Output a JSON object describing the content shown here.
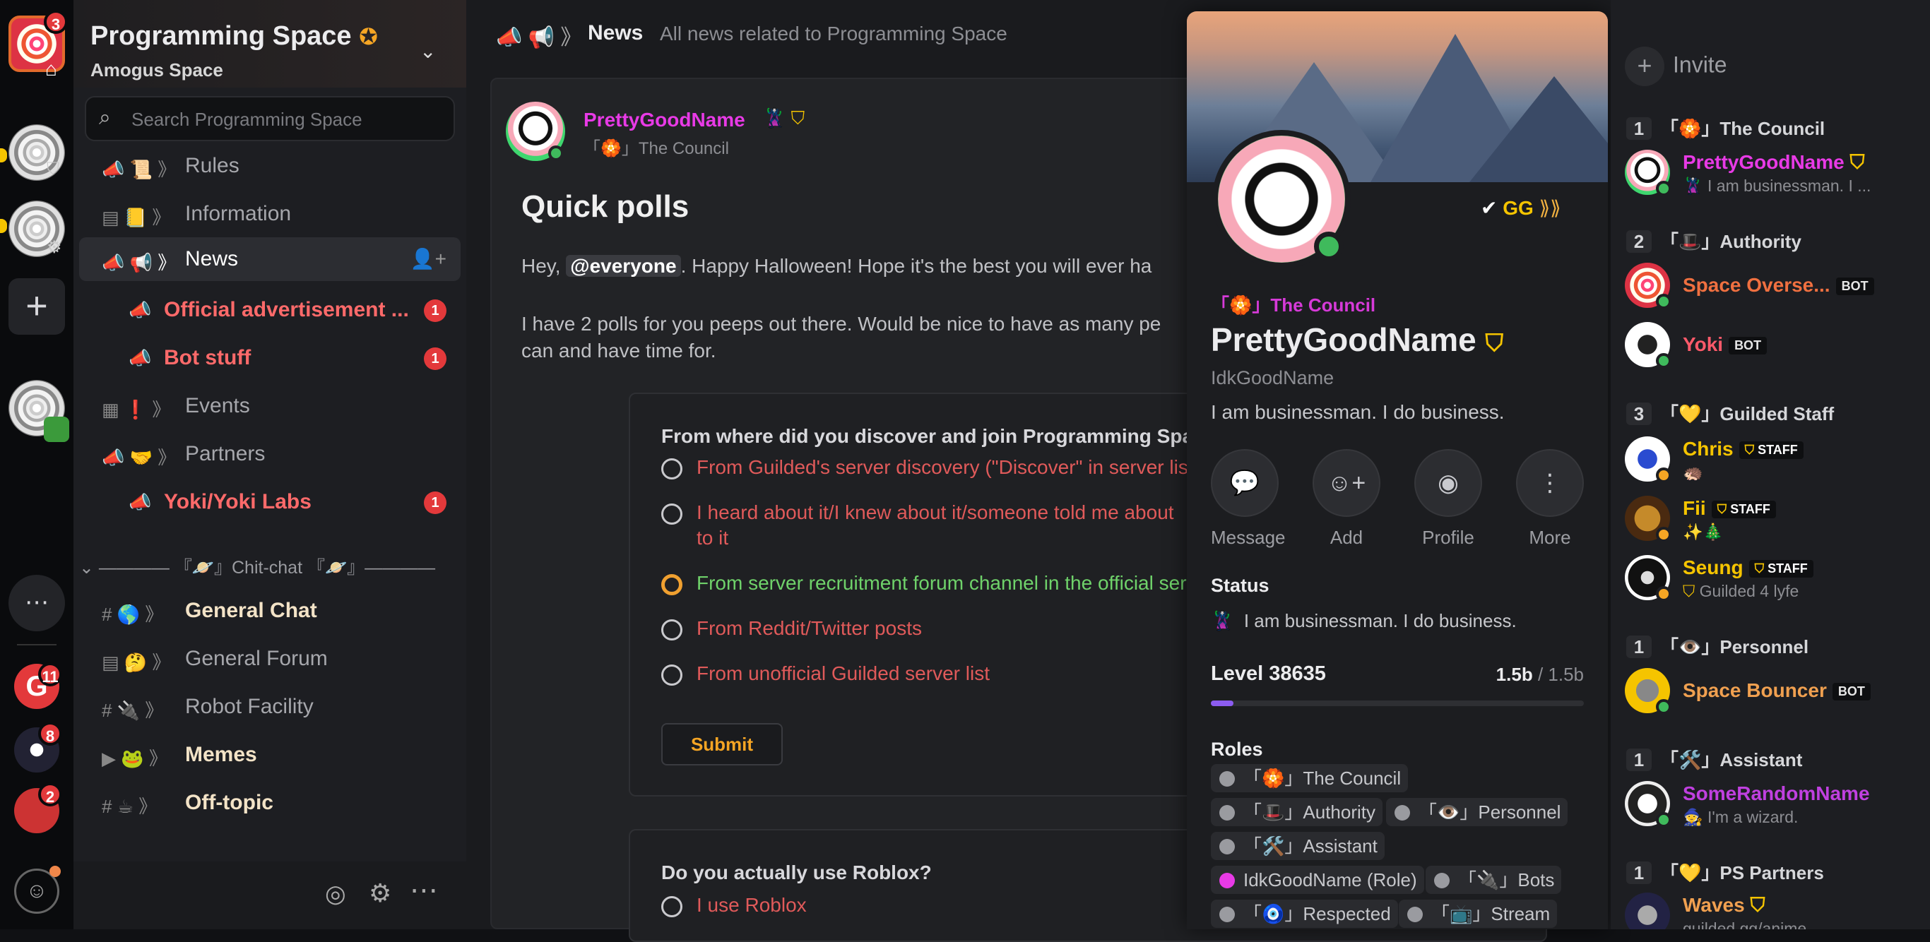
{
  "server": {
    "name": "Programming Space",
    "subtitle": "Amogus Space",
    "search_placeholder": "Search Programming Space",
    "rail_badges": [
      "3",
      "11",
      "8",
      "2"
    ]
  },
  "channels": [
    {
      "icon": "📜",
      "label": "Rules"
    },
    {
      "icon": "📒",
      "label": "Information"
    },
    {
      "icon": "📢",
      "label": "News"
    },
    {
      "icon": "",
      "label": "Official advertisement ...",
      "unread": "1"
    },
    {
      "icon": "",
      "label": "Bot stuff",
      "unread": "1"
    },
    {
      "icon": "❗",
      "label": "Events"
    },
    {
      "icon": "🤝",
      "label": "Partners"
    },
    {
      "icon": "",
      "label": "Yoki/Yoki Labs",
      "unread": "1"
    },
    {
      "icon": "🌎",
      "label": "General Chat"
    },
    {
      "icon": "🤔",
      "label": "General Forum"
    },
    {
      "icon": "🔌",
      "label": "Robot Facility"
    },
    {
      "icon": "🐸",
      "label": "Memes"
    },
    {
      "icon": "☕",
      "label": "Off-topic"
    }
  ],
  "category": "———— 『🪐』Chit-chat 『🪐』————",
  "topbar": {
    "title": "News",
    "description": "All news related to Programming Space"
  },
  "post": {
    "author": "PrettyGoodName",
    "author_role": "「🏵️」The Council",
    "title": "Quick polls",
    "line1_pre": "Hey, ",
    "mention": "@everyone",
    "line1_post": ". Happy Halloween! Hope it's the best you will ever ha",
    "line2": "I have 2 polls for you peeps out there. Would be nice to have as many pe",
    "line3": "can and have time for.",
    "poll1": {
      "question": "From where did you discover and join Programming Spac",
      "options": [
        "From Guilded's server discovery (\"Discover\" in server lis",
        "I heard about it/I knew about it/someone told me about",
        "to it",
        "From server recruitment forum channel in the official ser",
        "From Reddit/Twitter posts",
        "From unofficial Guilded server list"
      ],
      "submit": "Submit"
    },
    "poll2": {
      "question": "Do you actually use Roblox?",
      "option1": "I use Roblox"
    }
  },
  "card": {
    "role": "「🏵️」The Council",
    "name": "PrettyGoodName",
    "username": "IdkGoodName",
    "bio": "I am businessman. I do business.",
    "actions": [
      {
        "label": "Message"
      },
      {
        "label": "Add"
      },
      {
        "label": "Profile"
      },
      {
        "label": "More"
      }
    ],
    "status_title": "Status",
    "status_text": "I am businessman. I do business.",
    "level_label": "Level 38635",
    "xp": "1.5b",
    "xp_max": "/ 1.5b",
    "level_progress": 0.06,
    "roles_title": "Roles",
    "roles": [
      "「🏵️」The Council",
      "「🎩」Authority",
      "「👁️」Personnel",
      "「🛠️」Assistant",
      "IdkGoodName (Role)",
      "「🔌」Bots",
      "「🧿」Respected",
      "「📺」Stream"
    ],
    "badge_text": "GG"
  },
  "members": {
    "invite": "Invite",
    "groups": [
      {
        "count": "1",
        "name": "「🏵️」The Council"
      },
      {
        "count": "2",
        "name": "「🎩」Authority"
      },
      {
        "count": "3",
        "name": "「💛」Guilded Staff"
      },
      {
        "count": "1",
        "name": "「👁️」Personnel"
      },
      {
        "count": "1",
        "name": "「🛠️」Assistant"
      },
      {
        "count": "1",
        "name": "「💛」PS Partners"
      }
    ],
    "list": [
      {
        "name": "PrettyGoodName",
        "sub": "I am businessman. I ..."
      },
      {
        "name": "Space Overse...",
        "tag": "BOT"
      },
      {
        "name": "Yoki",
        "tag": "BOT"
      },
      {
        "name": "Chris",
        "tag": "STAFF",
        "sub": "🦔"
      },
      {
        "name": "Fii",
        "tag": "STAFF",
        "sub": "✨🎄"
      },
      {
        "name": "Seung",
        "tag": "STAFF",
        "sub": "Guilded 4 lyfe"
      },
      {
        "name": "Space Bouncer",
        "tag": "BOT"
      },
      {
        "name": "SomeRandomName",
        "sub": "I'm a wizard."
      },
      {
        "name": "Waves",
        "sub": "guilded.gg/anime"
      }
    ]
  },
  "colors": {
    "accent": "#f5a524",
    "council": "#e83ae6",
    "red": "#e05a5a",
    "green": "#6fd26a",
    "online": "#3fba5c"
  }
}
